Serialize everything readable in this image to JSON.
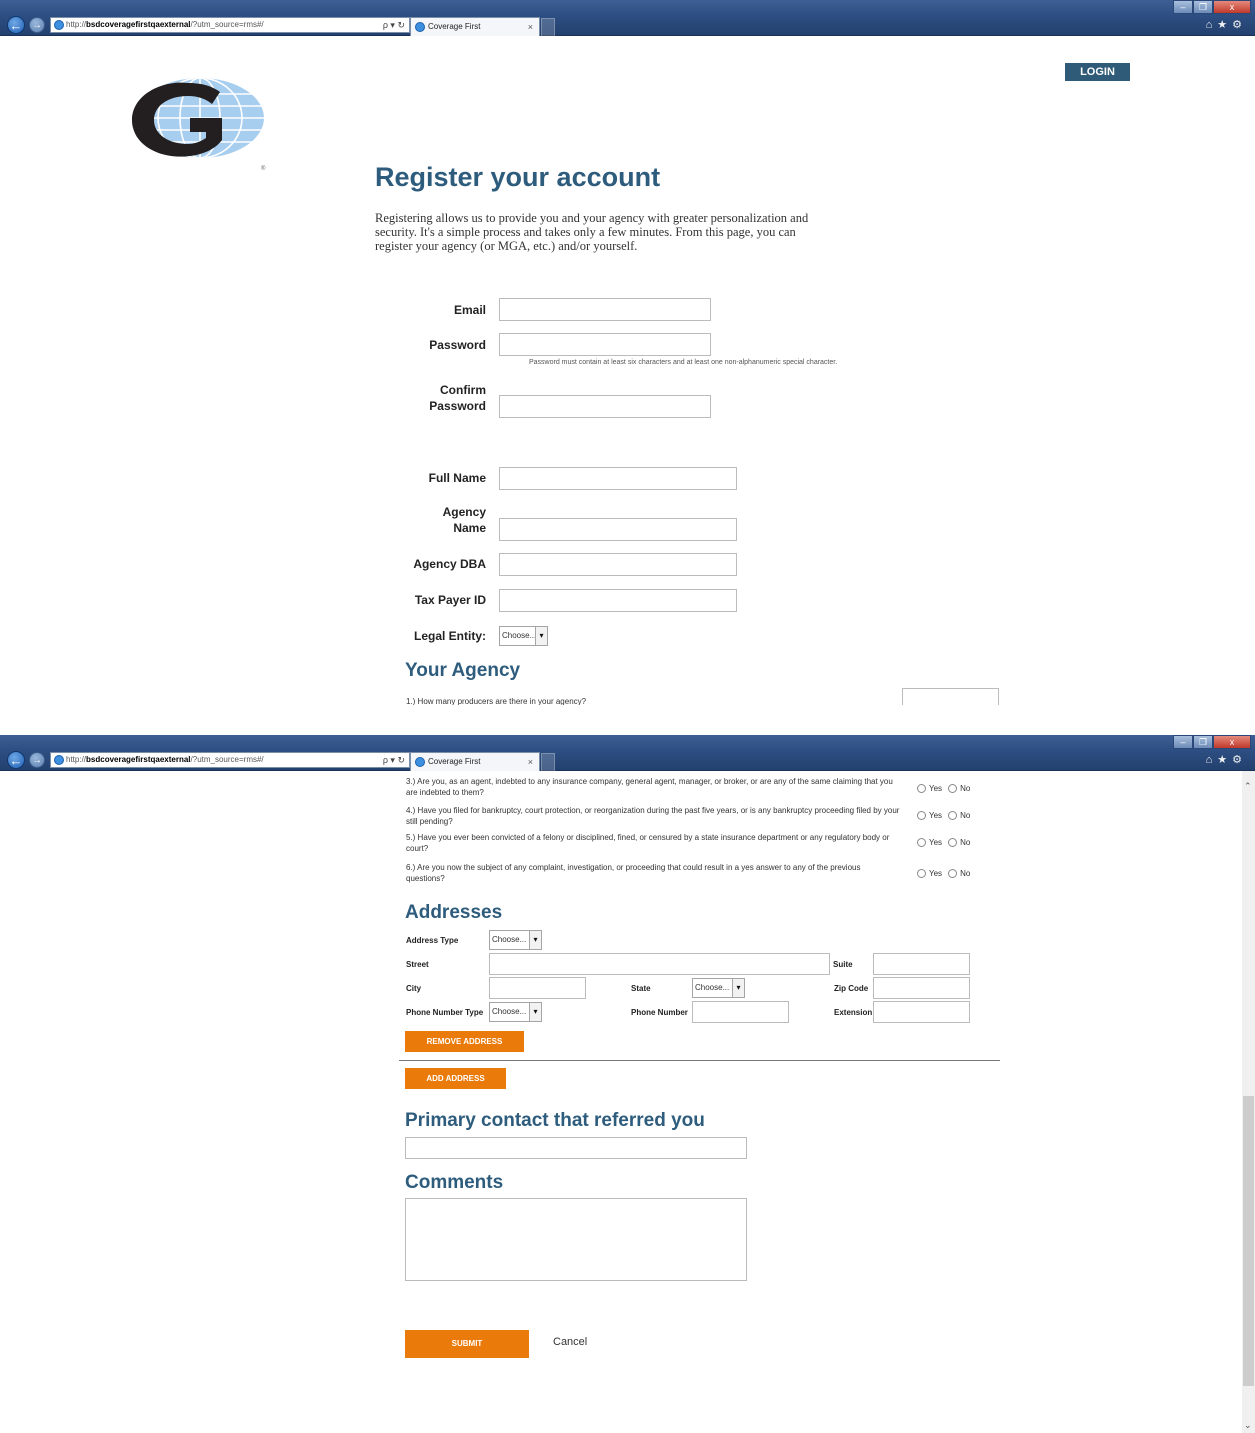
{
  "browser": {
    "url_prefix": "http://",
    "url_host": "bsdcoveragefirstqaexternal",
    "url_path": "/?utm_source=rms#/",
    "address_tools": "ρ ▾ ↻",
    "tab_title": "Coverage First",
    "tab_close": "×",
    "window_min": "–",
    "window_max": "❐",
    "window_close": "x",
    "right_icons": "⌂★⚙"
  },
  "header": {
    "login_label": "LOGIN"
  },
  "page": {
    "title": "Register your account",
    "intro": "Registering allows us to provide you and your agency with greater personalization and security. It's a simple process and takes only a few minutes. From this page, you can register your agency (or MGA, etc.) and/or yourself."
  },
  "account": {
    "email_label": "Email",
    "password_label": "Password",
    "password_hint": "Password must contain at least six characters and at least one non-alphanumeric special character.",
    "confirm_label_1": "Confirm",
    "confirm_label_2": "Password"
  },
  "agency_info": {
    "full_name_label": "Full Name",
    "agency_name_label_1": "Agency",
    "agency_name_label_2": "Name",
    "agency_dba_label": "Agency DBA",
    "tax_payer_label": "Tax Payer ID",
    "legal_entity_label": "Legal Entity:",
    "legal_entity_value": "Choose..."
  },
  "your_agency": {
    "heading": "Your Agency",
    "q1": "1.) How many producers are there in your agency?"
  },
  "questions": [
    {
      "text": "3.) Are you, as an agent, indebted to any insurance company, general agent, manager, or broker, or are any of the same claiming that you are indebted to them?",
      "yes": "Yes",
      "no": "No"
    },
    {
      "text": "4.) Have you filed for bankruptcy, court protection, or reorganization during the past five years, or is any bankruptcy proceeding filed by your still pending?",
      "yes": "Yes",
      "no": "No"
    },
    {
      "text": "5.) Have you ever been convicted of a felony or disciplined, fined, or censured by a state insurance department or any regulatory body or court?",
      "yes": "Yes",
      "no": "No"
    },
    {
      "text": "6.) Are you now the subject of any complaint, investigation, or proceeding that could result in a yes answer to any of the previous questions?",
      "yes": "Yes",
      "no": "No"
    }
  ],
  "addresses": {
    "heading": "Addresses",
    "address_type_label": "Address Type",
    "address_type_value": "Choose...",
    "street_label": "Street",
    "suite_label": "Suite",
    "city_label": "City",
    "state_label": "State",
    "state_value": "Choose...",
    "zip_label": "Zip Code",
    "phone_type_label": "Phone Number Type",
    "phone_type_value": "Choose...",
    "phone_number_label": "Phone Number",
    "extension_label": "Extension",
    "remove_label": "REMOVE ADDRESS",
    "add_label": "ADD ADDRESS"
  },
  "referral": {
    "heading": "Primary contact that referred you"
  },
  "comments": {
    "heading": "Comments"
  },
  "actions": {
    "submit_label": "SUBMIT",
    "cancel_label": "Cancel"
  },
  "colors": {
    "brand_blue": "#2e5c7d",
    "button_orange": "#ea7a0a",
    "login_bg": "#2f5a78"
  },
  "icons": [
    "back-icon",
    "forward-icon",
    "ie-icon",
    "home-icon",
    "star-icon",
    "gear-icon",
    "chevron-down-icon",
    "scroll-up-icon",
    "scroll-down-icon"
  ]
}
